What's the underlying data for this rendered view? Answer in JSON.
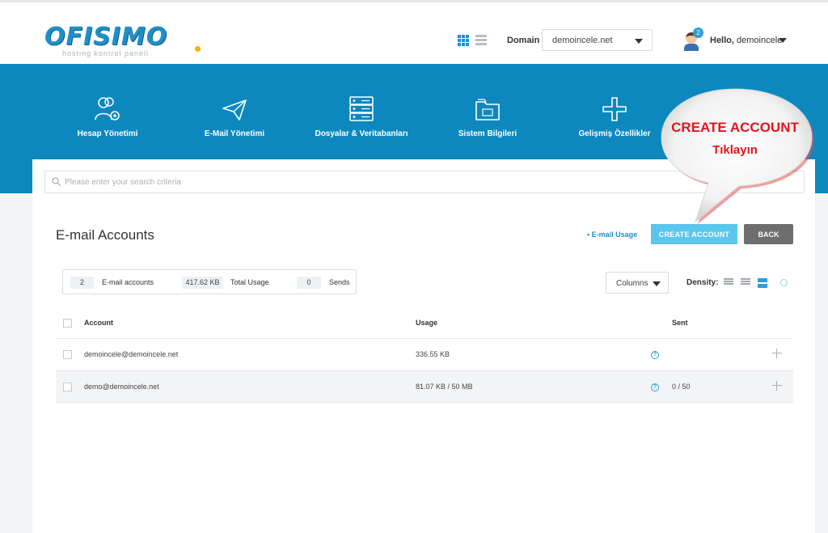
{
  "header": {
    "logo_text": "OFISIMO",
    "logo_sub": "hosting kontrol paneli",
    "domain_label": "Domain",
    "domain_value": "demoincele.net",
    "notification_count": "2",
    "hello_prefix": "Hello,",
    "username": "demoincele"
  },
  "nav": {
    "items": [
      {
        "label": "Hesap Yönetimi",
        "icon": "users-gear-icon"
      },
      {
        "label": "E-Mail Yönetimi",
        "icon": "paper-plane-icon"
      },
      {
        "label": "Dosyalar & Veritabanları",
        "icon": "server-database-icon"
      },
      {
        "label": "Sistem Bilgileri",
        "icon": "folder-icon"
      },
      {
        "label": "Gelişmiş Özellikler",
        "icon": "plus-icon"
      }
    ]
  },
  "search": {
    "placeholder": "Please enter your search criteria"
  },
  "page": {
    "title": "E-mail Accounts",
    "usage_link": "• E-mail Usage",
    "create_button": "CREATE ACCOUNT",
    "back_button": "BACK"
  },
  "stats": {
    "accounts_value": "2",
    "accounts_label": "E-mail accounts",
    "usage_value": "417.62 KB",
    "usage_label": "Total Usage",
    "sends_value": "0",
    "sends_label": "Sends"
  },
  "controls": {
    "columns_label": "Columns",
    "density_label": "Density:"
  },
  "table": {
    "headers": {
      "account": "Account",
      "usage": "Usage",
      "sent": "Sent"
    },
    "rows": [
      {
        "account": "demoincele@demoincele.net",
        "usage": "336.55 KB",
        "sent": ""
      },
      {
        "account": "demo@demoincele.net",
        "usage": "81.07 KB / 50 MB",
        "sent": "0 / 50"
      }
    ]
  },
  "callout": {
    "title": "CREATE ACCOUNT",
    "subtitle": "Tıklayın"
  },
  "colors": {
    "brand_blue": "#0c88be",
    "accent": "#5bc6ee",
    "callout_red": "#e3141b"
  }
}
